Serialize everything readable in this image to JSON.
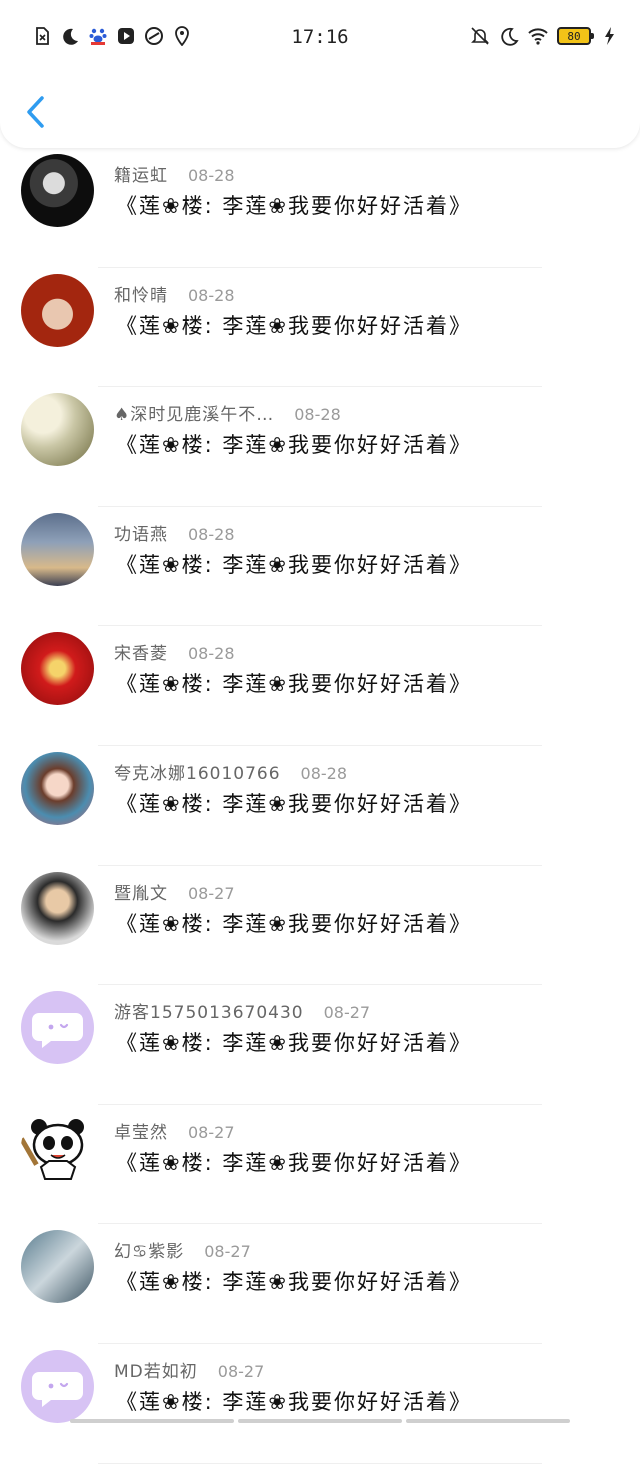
{
  "status_bar": {
    "time": "17:16",
    "battery": "80",
    "left_icons": [
      "no-sim-icon",
      "moon-icon",
      "baidu-paw-icon",
      "video-icon",
      "shield-app-icon",
      "location-pin-icon"
    ],
    "right_icons": [
      "bell-off-icon",
      "moon-icon",
      "wifi-icon",
      "battery-icon",
      "charging-bolt-icon"
    ]
  },
  "header": {
    "back_icon": "chevron-left-icon"
  },
  "comments": [
    {
      "name": "籍运虹",
      "date": "08-28",
      "message": "《莲❀楼: 李莲❀我要你好好活着》",
      "avatar": "photo-dark"
    },
    {
      "name": "和怜晴",
      "date": "08-28",
      "message": "《莲❀楼: 李莲❀我要你好好活着》",
      "avatar": "photo-red"
    },
    {
      "name": "♠深时见鹿溪午不…",
      "date": "08-28",
      "message": "《莲❀楼: 李莲❀我要你好好活着》",
      "avatar": "photo-deer"
    },
    {
      "name": "功语燕",
      "date": "08-28",
      "message": "《莲❀楼: 李莲❀我要你好好活着》",
      "avatar": "photo-sky"
    },
    {
      "name": "宋香菱",
      "date": "08-28",
      "message": "《莲❀楼: 李莲❀我要你好好活着》",
      "avatar": "photo-poster"
    },
    {
      "name": "夸克冰娜16010766",
      "date": "08-28",
      "message": "《莲❀楼: 李莲❀我要你好好活着》",
      "avatar": "photo-anime-girl"
    },
    {
      "name": "暨胤文",
      "date": "08-27",
      "message": "《莲❀楼: 李莲❀我要你好好活着》",
      "avatar": "photo-man"
    },
    {
      "name": "游客1575013670430",
      "date": "08-27",
      "message": "《莲❀楼: 李莲❀我要你好好活着》",
      "avatar": "default-chat"
    },
    {
      "name": "卓莹然",
      "date": "08-27",
      "message": "《莲❀楼: 李莲❀我要你好好活着》",
      "avatar": "panda"
    },
    {
      "name": "幻♋紫影",
      "date": "08-27",
      "message": "《莲❀楼: 李莲❀我要你好好活着》",
      "avatar": "photo-costume"
    },
    {
      "name": "MD若如初",
      "date": "08-27",
      "message": "《莲❀楼: 李莲❀我要你好好活着》",
      "avatar": "default-chat"
    }
  ],
  "colors": {
    "accent": "#2f9cf0",
    "default_avatar": "#d7c3f4",
    "battery": "#f2c318"
  }
}
